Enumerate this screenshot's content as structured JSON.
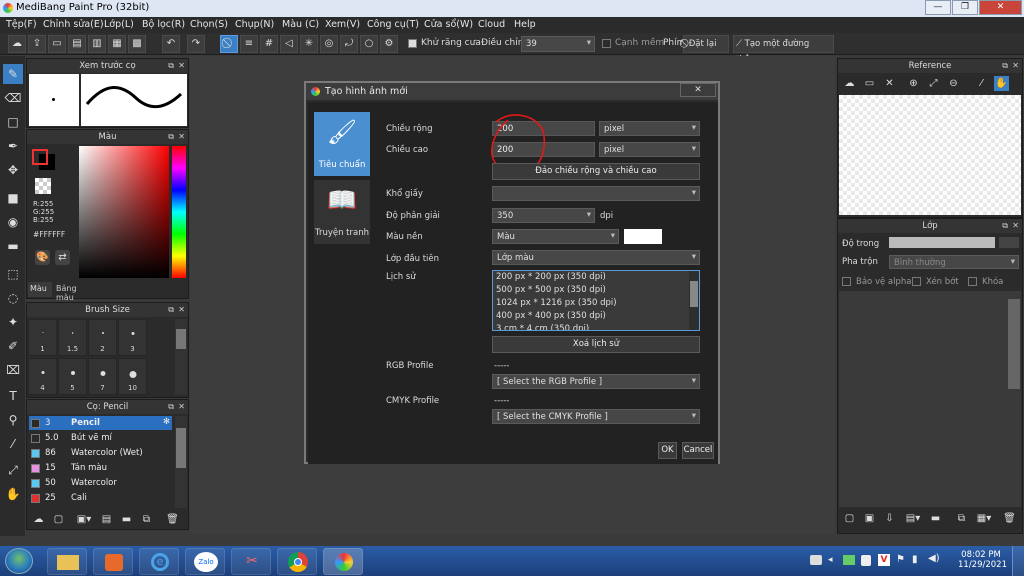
{
  "window": {
    "title": "MediBang Paint Pro (32bit)"
  },
  "menu": [
    "Tệp(F)",
    "Chỉnh sửa(E)",
    "Lớp(L)",
    "Bộ lọc(R)",
    "Chọn(S)",
    "Chụp(N)",
    "Màu (C)",
    "Xem(V)",
    "Công cụ(T)",
    "Cửa sổ(W)",
    "Cloud",
    "Help"
  ],
  "toolbar": {
    "antialias_label": "Khử răng cưa",
    "adjust_label": "Điều chỉnh",
    "adjust_value": "39",
    "edge_label": "Cạnh mềm",
    "key_label": "Phím",
    "reset_label": "Đặt lại",
    "straight_label": "Tạo một đường thẳng"
  },
  "preview_panel": {
    "title": "Xem trước cọ"
  },
  "color_panel": {
    "title": "Màu",
    "r": "R:255",
    "g": "G:255",
    "b": "B:255",
    "hex": "#FFFFFF",
    "tabs": [
      "Màu",
      "Bảng màu"
    ],
    "fg_color": "#ffffff",
    "bg_color": "#000000"
  },
  "brush_size_panel": {
    "title": "Brush Size",
    "sizes": [
      "1",
      "1.5",
      "2",
      "3",
      "4",
      "5",
      "7",
      "10"
    ]
  },
  "brush_panel": {
    "title": "Cọ: Pencil",
    "items": [
      {
        "size": "3",
        "name": "Pencil",
        "color": "#2a6fc0"
      },
      {
        "size": "5.0",
        "name": "Bút vẽ mí",
        "color": "#2a2a2a"
      },
      {
        "size": "86",
        "name": "Watercolor (Wet)",
        "color": "#5ac8f0"
      },
      {
        "size": "15",
        "name": "Tán màu",
        "color": "#e890e0"
      },
      {
        "size": "50",
        "name": "Watercolor",
        "color": "#5ac8f0"
      },
      {
        "size": "25",
        "name": "Cali",
        "color": "#e03030"
      }
    ]
  },
  "reference_panel": {
    "title": "Reference"
  },
  "layer_panel": {
    "title": "Lớp",
    "opacity_label": "Độ trong",
    "blend_label": "Pha trộn",
    "blend_value": "Bình thường",
    "protect_alpha": "Bảo vệ alpha",
    "clipping": "Xén bớt",
    "lock": "Khóa"
  },
  "dialog": {
    "title": "Tạo hình ảnh mới",
    "tab_standard": "Tiêu chuẩn",
    "tab_comic": "Truyện tranh",
    "width_label": "Chiều rộng",
    "width_value": "200",
    "width_unit": "pixel",
    "height_label": "Chiều cao",
    "height_value": "200",
    "height_unit": "pixel",
    "swap_button": "Đảo chiều rộng và chiều cao",
    "paper_label": "Khổ giấy",
    "paper_value": "",
    "resolution_label": "Độ phân giải",
    "resolution_value": "350",
    "resolution_unit": "dpi",
    "bg_label": "Màu nền",
    "bg_value": "Màu",
    "bg_color": "#ffffff",
    "first_layer_label": "Lớp đầu tiên",
    "first_layer_value": "Lớp màu",
    "history_label": "Lịch sử",
    "history": [
      "200 px * 200 px (350 dpi)",
      "500 px * 500 px (350 dpi)",
      "1024 px * 1216 px (350 dpi)",
      "400 px * 400 px (350 dpi)",
      "3 cm * 4 cm (350 dpi)"
    ],
    "clear_history": "Xoá lịch sử",
    "rgb_label": "RGB Profile",
    "rgb_dash": "-----",
    "rgb_select": "[ Select the RGB Profile ]",
    "cmyk_label": "CMYK Profile",
    "cmyk_dash": "-----",
    "cmyk_select": "[ Select the CMYK Profile ]",
    "ok": "OK",
    "cancel": "Cancel"
  },
  "taskbar": {
    "time": "08:02 PM",
    "date": "11/29/2021",
    "zalo": "Zalo"
  }
}
